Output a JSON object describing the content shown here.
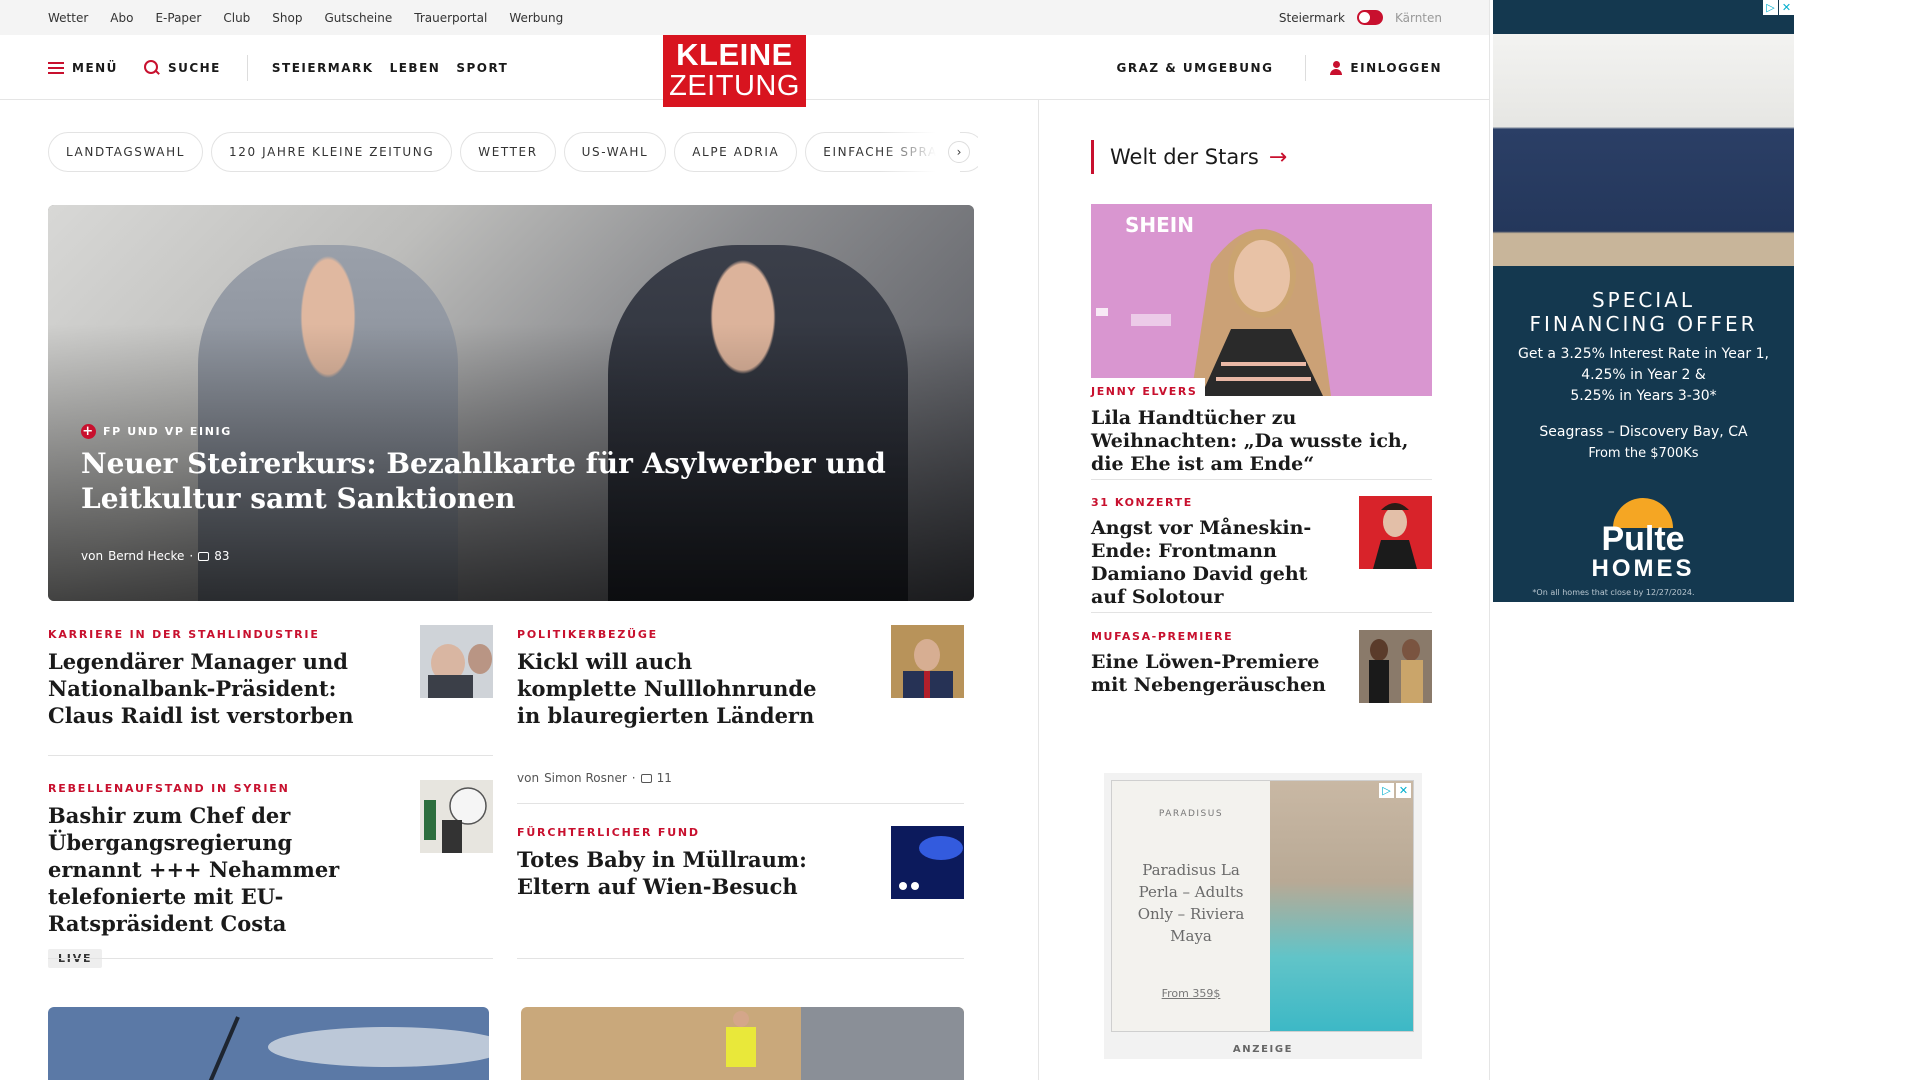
{
  "utility_nav": {
    "links": [
      "Wetter",
      "Abo",
      "E-Paper",
      "Club",
      "Shop",
      "Gutscheine",
      "Trauerportal",
      "Werbung"
    ],
    "region_left": "Steiermark",
    "region_right": "Kärnten"
  },
  "header": {
    "menu_label": "MENÜ",
    "search_label": "SUCHE",
    "nav": [
      "STEIERMARK",
      "LEBEN",
      "SPORT"
    ],
    "logo_line1": "KLEINE",
    "logo_line2": "ZEITUNG",
    "region_link": "GRAZ & UMGEBUNG",
    "login_label": "EINLOGGEN"
  },
  "tags": [
    "LANDTAGSWAHL",
    "120 JAHRE KLEINE ZEITUNG",
    "WETTER",
    "US-WAHL",
    "ALPE ADRIA",
    "EINFACHE SPRACHE"
  ],
  "tags_next_glyph": "›",
  "hero": {
    "kicker": "FP UND VP EINIG",
    "title": "Neuer Steirerkurs: Bezahlkarte für Asylwerber und Leitkultur samt Sanktionen",
    "byline_prefix": "von",
    "author": "Bernd Hecke",
    "comments": "83",
    "dot": "·"
  },
  "articles": {
    "a1": {
      "kicker": "KARRIERE IN DER STAHLINDUSTRIE",
      "title": "Legendärer Manager und Nationalbank-Präsident: Claus Raidl ist verstorben"
    },
    "a2": {
      "kicker": "POLITIKERBEZÜGE",
      "title": "Kickl will auch komplette Nulllohnrunde in blauregierten Ländern",
      "byline_prefix": "von",
      "author": "Simon Rosner",
      "comments": "11"
    },
    "a3": {
      "kicker": "REBELLENAUFSTAND IN SYRIEN",
      "title": "Bashir zum Chef der Übergangsregierung ernannt +++ Nehammer telefonierte mit EU-Ratspräsident Costa",
      "badge": "LIVE"
    },
    "a4": {
      "kicker": "FÜRCHTERLICHER FUND",
      "title": "Totes Baby in Müllraum: Eltern auf Wien-Besuch"
    }
  },
  "sidebar": {
    "section_title": "Welt der Stars",
    "arrow": "→",
    "image_overlay_text": "SHEIN",
    "s1": {
      "kicker": "JENNY ELVERS",
      "title": "Lila Handtücher zu Weihnachten: „Da wusste ich, die Ehe ist am Ende“"
    },
    "s2": {
      "kicker": "31 KONZERTE",
      "title": "Angst vor Måneskin-Ende: Frontmann Damiano David geht auf Solotour"
    },
    "s3": {
      "kicker": "MUFASA-PREMIERE",
      "title": "Eine Löwen-Premiere mit Nebengeräuschen"
    }
  },
  "sidebar_ad": {
    "brand": "PARADISUS",
    "headline": "Paradisus La Perla – Adults Only – Riviera Maya",
    "price": "From 359$",
    "label": "ANZEIGE"
  },
  "banner_ad": {
    "headline1": "SPECIAL",
    "headline2": "FINANCING OFFER",
    "rates1": "Get a 3.25% Interest Rate in Year 1,",
    "rates2": "4.25% in Year 2 &",
    "rates3": "5.25% in Years 3-30*",
    "location": "Seagrass – Discovery Bay, CA",
    "price": "From the $700Ks",
    "brand1": "Pulte",
    "brand2": "HOMES",
    "disclaimer": "*On all homes that close by 12/27/2024."
  },
  "colors": {
    "brand_red": "#c8102e",
    "logo_red": "#d8141f",
    "banner_navy": "#14384f"
  }
}
